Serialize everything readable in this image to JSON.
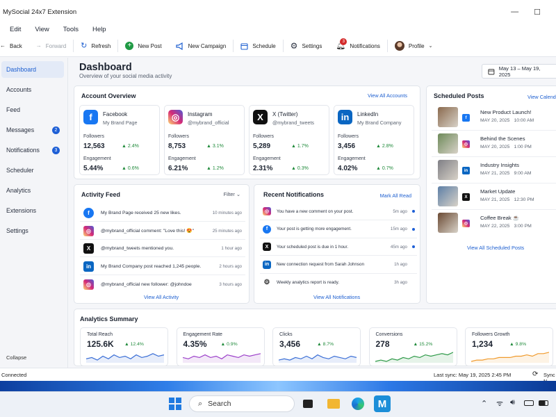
{
  "window": {
    "title": "MySocial 24x7 Extension"
  },
  "menu": [
    "Edit",
    "View",
    "Tools",
    "Help"
  ],
  "toolbar": {
    "back": "Back",
    "forward": "Forward",
    "refresh": "Refresh",
    "new_post": "New Post",
    "new_campaign": "New Campaign",
    "schedule": "Schedule",
    "settings": "Settings",
    "notifications": "Notifications",
    "notifications_count": "3",
    "profile": "Profile"
  },
  "sidebar": {
    "items": [
      {
        "label": "Dashboard",
        "badge": ""
      },
      {
        "label": "Accounts",
        "badge": ""
      },
      {
        "label": "Feed",
        "badge": ""
      },
      {
        "label": "Messages",
        "badge": "2"
      },
      {
        "label": "Notifications",
        "badge": "3"
      },
      {
        "label": "Scheduler",
        "badge": ""
      },
      {
        "label": "Analytics",
        "badge": ""
      },
      {
        "label": "Extensions",
        "badge": ""
      },
      {
        "label": "Settings",
        "badge": ""
      }
    ],
    "collapse": "Collapse"
  },
  "page": {
    "title": "Dashboard",
    "subtitle": "Overview of your social media activity",
    "date_range": "May 13 – May 19, 2025"
  },
  "account_overview": {
    "title": "Account Overview",
    "link": "View All Accounts",
    "followers_label": "Followers",
    "engagement_label": "Engagement",
    "accounts": [
      {
        "name": "Facebook",
        "handle": "My Brand Page",
        "followers": "12,563",
        "followers_change": "2.4%",
        "engagement": "5.44%",
        "engagement_change": "0.6%",
        "color": "#1877f2",
        "glyph": "f"
      },
      {
        "name": "Instagram",
        "handle": "@mybrand_official",
        "followers": "8,753",
        "followers_change": "3.1%",
        "engagement": "6.21%",
        "engagement_change": "1.2%",
        "color": "#d6249f",
        "glyph": "◎"
      },
      {
        "name": "X (Twitter)",
        "handle": "@mybrand_tweets",
        "followers": "5,289",
        "followers_change": "1.7%",
        "engagement": "2.31%",
        "engagement_change": "0.3%",
        "color": "#111111",
        "glyph": "X"
      },
      {
        "name": "LinkedIn",
        "handle": "My Brand Company",
        "followers": "3,456",
        "followers_change": "2.8%",
        "engagement": "4.02%",
        "engagement_change": "0.7%",
        "color": "#0a66c2",
        "glyph": "in"
      }
    ]
  },
  "activity_feed": {
    "title": "Activity Feed",
    "filter": "Filter",
    "link": "View All Activity",
    "items": [
      {
        "icon": "facebook-icon",
        "color": "#1877f2",
        "glyph": "f",
        "text": "My Brand Page received 25 new likes.",
        "time": "10 minutes ago"
      },
      {
        "icon": "instagram-icon",
        "color": "#d6249f",
        "glyph": "◎",
        "text": "@mybrand_official comment: \"Love this! 😍\"",
        "time": "25 minutes ago"
      },
      {
        "icon": "x-icon",
        "color": "#111111",
        "glyph": "X",
        "text": "@mybrand_tweets mentioned you.",
        "time": "1 hour ago"
      },
      {
        "icon": "linkedin-icon",
        "color": "#0a66c2",
        "glyph": "in",
        "text": "My Brand Company post reached 1,245 people.",
        "time": "2 hours ago"
      },
      {
        "icon": "instagram-icon",
        "color": "#d6249f",
        "glyph": "◎",
        "text": "@mybrand_official new follower: @johndoe",
        "time": "3 hours ago"
      }
    ]
  },
  "recent_notifications": {
    "title": "Recent Notifications",
    "link_top": "Mark All Read",
    "link": "View All Notifications",
    "items": [
      {
        "icon": "instagram-icon",
        "color": "#d6249f",
        "glyph": "◎",
        "text": "You have a new comment on your post.",
        "time": "5m ago",
        "unread": true
      },
      {
        "icon": "facebook-icon",
        "color": "#1877f2",
        "glyph": "f",
        "text": "Your post is getting more engagement.",
        "time": "15m ago",
        "unread": true
      },
      {
        "icon": "x-icon",
        "color": "#111111",
        "glyph": "X",
        "text": "Your scheduled post is due in 1 hour.",
        "time": "45m ago",
        "unread": true
      },
      {
        "icon": "linkedin-icon",
        "color": "#0a66c2",
        "glyph": "in",
        "text": "New connection request from Sarah Johnson",
        "time": "1h ago",
        "unread": false
      },
      {
        "icon": "gear-icon",
        "color": "#ffffff",
        "glyph": "⚙",
        "text": "Weekly analytics report is ready.",
        "time": "3h ago",
        "unread": false
      }
    ]
  },
  "scheduled_posts": {
    "title": "Scheduled Posts",
    "link_top": "View Calendar",
    "link": "View All Scheduled Posts",
    "items": [
      {
        "title": "New Product Launch!",
        "date": "MAY 20, 2025",
        "time": "10:00 AM",
        "color": "#1877f2",
        "glyph": "f",
        "thumb": "#8a6a4e"
      },
      {
        "title": "Behind the Scenes",
        "date": "MAY 20, 2025",
        "time": "1:00 PM",
        "color": "#d6249f",
        "glyph": "◎",
        "thumb": "#6e8a5a"
      },
      {
        "title": "Industry Insights",
        "date": "MAY 21, 2025",
        "time": "9:00 AM",
        "color": "#0a66c2",
        "glyph": "in",
        "thumb": "#7f7f85"
      },
      {
        "title": "Market Update",
        "date": "MAY 21, 2025",
        "time": "12:30 PM",
        "color": "#111111",
        "glyph": "X",
        "thumb": "#5d7fa6"
      },
      {
        "title": "Coffee Break ☕",
        "date": "MAY 22, 2025",
        "time": "3:00 PM",
        "color": "#d6249f",
        "glyph": "◎",
        "thumb": "#6b4a33"
      }
    ]
  },
  "analytics": {
    "title": "Analytics Summary",
    "metrics": [
      {
        "label": "Total Reach",
        "value": "125.6K",
        "change": "12.4%",
        "color": "#3b6fd6"
      },
      {
        "label": "Engagement Rate",
        "value": "4.35%",
        "change": "0.9%",
        "color": "#9b3fc9"
      },
      {
        "label": "Clicks",
        "value": "3,456",
        "change": "8.7%",
        "color": "#3b6fd6"
      },
      {
        "label": "Conversions",
        "value": "278",
        "change": "15.2%",
        "color": "#2f9a49"
      },
      {
        "label": "Followers Growth",
        "value": "1,234",
        "change": "9.8%",
        "color": "#f09a2c"
      }
    ]
  },
  "status": {
    "left": "Connected",
    "sync": "Last sync: May 19, 2025 2:45 PM",
    "sync_now": "Sync N"
  },
  "taskbar": {
    "search_placeholder": "Search"
  }
}
